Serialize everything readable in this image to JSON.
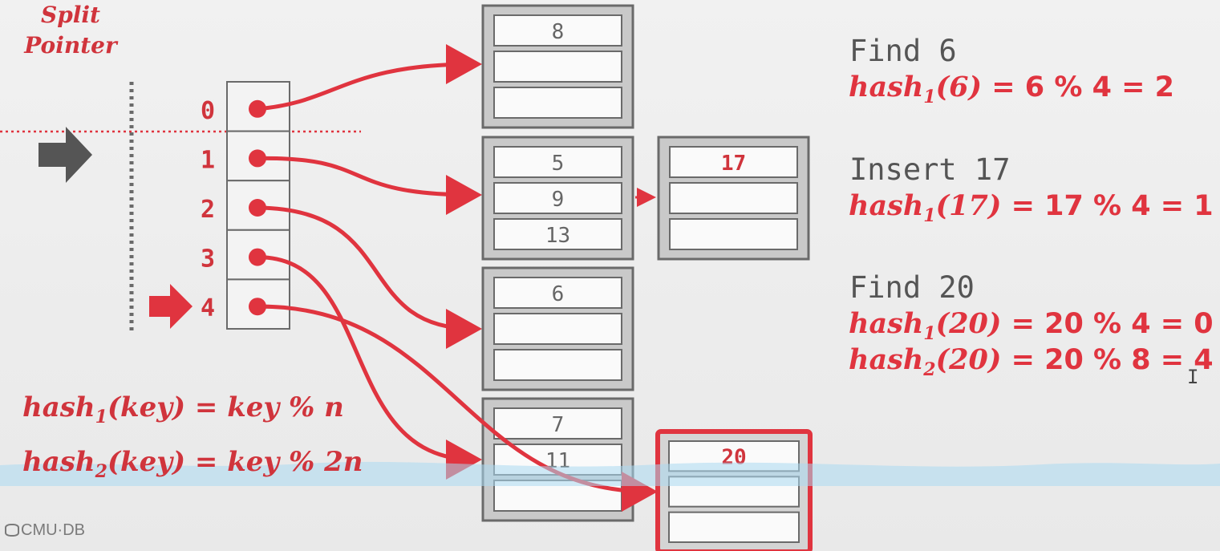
{
  "split_pointer": {
    "line1": "Split",
    "line2": "Pointer"
  },
  "directory": {
    "slots": [
      "0",
      "1",
      "2",
      "3",
      "4"
    ]
  },
  "buckets": [
    {
      "values": [
        "8",
        "",
        ""
      ]
    },
    {
      "values": [
        "5",
        "9",
        "13"
      ]
    },
    {
      "values": [
        "6",
        "",
        ""
      ]
    },
    {
      "values": [
        "7",
        "11",
        ""
      ]
    }
  ],
  "overflow_bucket": {
    "values": [
      "17",
      "",
      ""
    ]
  },
  "new_bucket": {
    "values": [
      "20",
      "",
      ""
    ]
  },
  "queries": [
    {
      "title": "Find 6",
      "lines": [
        {
          "fn": "hash",
          "sub": "1",
          "arg": "(6)",
          "expr": " =  6 % 4 = 2"
        }
      ]
    },
    {
      "title": "Insert 17",
      "lines": [
        {
          "fn": "hash",
          "sub": "1",
          "arg": "(17)",
          "expr": " =  17 % 4 = 1"
        }
      ]
    },
    {
      "title": "Find 20",
      "lines": [
        {
          "fn": "hash",
          "sub": "1",
          "arg": "(20)",
          "expr": " =  20 % 4 = 0"
        },
        {
          "fn": "hash",
          "sub": "2",
          "arg": "(20)",
          "expr": " =  20 % 8 = 4"
        }
      ]
    }
  ],
  "formulas": [
    {
      "fn": "hash",
      "sub": "1",
      "rest": "(key) = key % n"
    },
    {
      "fn": "hash",
      "sub": "2",
      "rest": "(key) = key % 2n"
    }
  ],
  "logo": {
    "text": "CMU·DB",
    "icon": "database-icon"
  },
  "colors": {
    "accent": "#e0343f",
    "box_border": "#6a6a6a",
    "bucket_fill": "#c9c9c9",
    "arrow_gray": "#555555",
    "wave": "#a9d8f0"
  }
}
